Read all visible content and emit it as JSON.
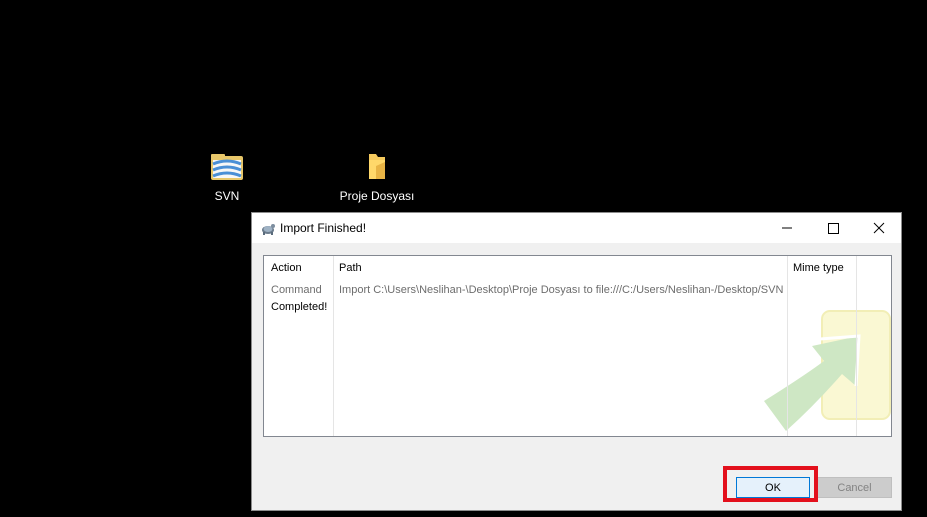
{
  "desktop": {
    "icons": [
      {
        "label": "SVN",
        "icon": "svn-repo-icon"
      },
      {
        "label": "Proje Dosyası",
        "icon": "folder-icon"
      }
    ]
  },
  "dialog": {
    "title": "Import Finished!",
    "columns": [
      "Action",
      "Path",
      "Mime type"
    ],
    "rows": [
      {
        "action": "Command",
        "path": "Import C:\\Users\\Neslihan-\\Desktop\\Proje Dosyası to file:///C:/Users/Neslihan-/Desktop/SVN",
        "mime": ""
      },
      {
        "action": "Completed!",
        "path": "",
        "mime": ""
      }
    ],
    "buttons": {
      "ok": "OK",
      "cancel": "Cancel"
    },
    "controls": [
      "minimize-icon",
      "maximize-icon",
      "close-icon"
    ]
  },
  "colors": {
    "highlight": "#e3101c",
    "ok_border": "#0078d7"
  }
}
